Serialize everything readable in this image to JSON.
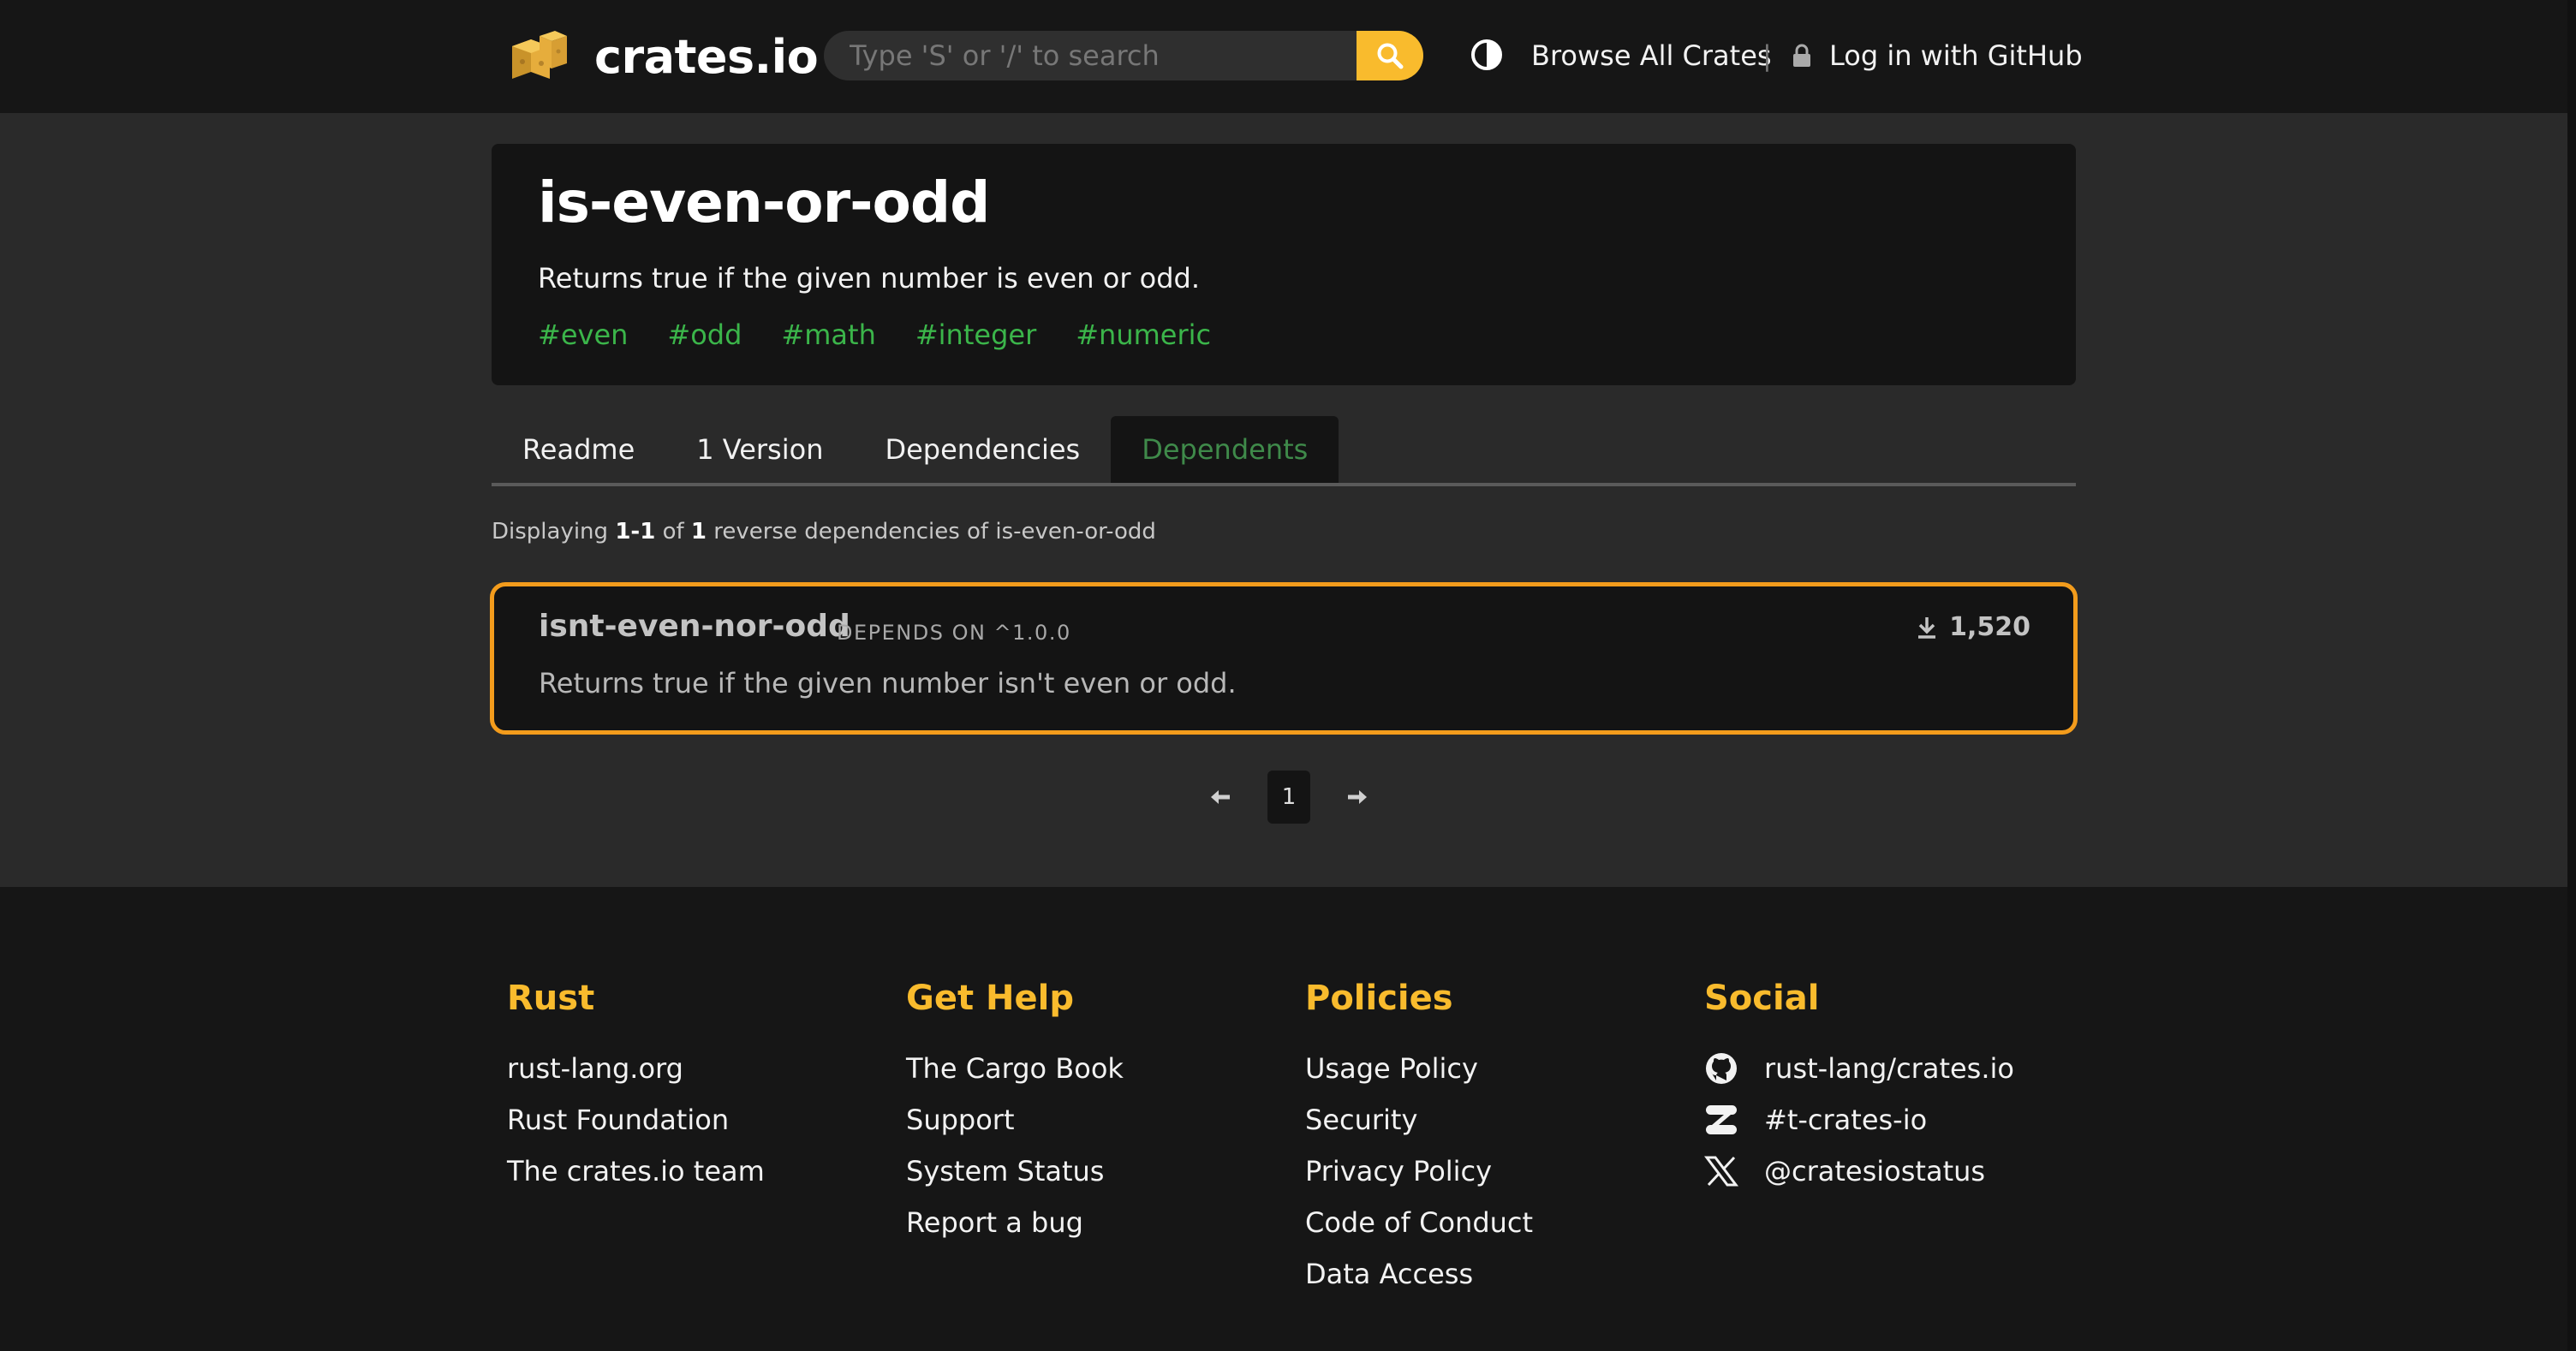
{
  "header": {
    "logo_text": "crates.io",
    "search_placeholder": "Type 'S' or '/' to search",
    "browse_label": "Browse All Crates",
    "separator": "|",
    "login_label": "Log in with GitHub"
  },
  "crate": {
    "name": "is-even-or-odd",
    "description": "Returns true if the given number is even or odd.",
    "keywords": [
      "#even",
      "#odd",
      "#math",
      "#integer",
      "#numeric"
    ]
  },
  "tabs": [
    {
      "label": "Readme",
      "active": false
    },
    {
      "label": "1 Version",
      "active": false
    },
    {
      "label": "Dependencies",
      "active": false
    },
    {
      "label": "Dependents",
      "active": true
    }
  ],
  "summary": {
    "prefix": "Displaying",
    "range": "1-1",
    "of": "of",
    "total": "1",
    "suffix": "reverse dependencies of is-even-or-odd"
  },
  "dependents": [
    {
      "name": "isnt-even-nor-odd",
      "requirement": "DEPENDS ON ^1.0.0",
      "downloads": "1,520",
      "description": "Returns true if the given number isn't even or odd."
    }
  ],
  "pagination": {
    "current_page": "1"
  },
  "footer": {
    "columns": [
      {
        "title": "Rust",
        "links": [
          "rust-lang.org",
          "Rust Foundation",
          "The crates.io team"
        ]
      },
      {
        "title": "Get Help",
        "links": [
          "The Cargo Book",
          "Support",
          "System Status",
          "Report a bug"
        ]
      },
      {
        "title": "Policies",
        "links": [
          "Usage Policy",
          "Security",
          "Privacy Policy",
          "Code of Conduct",
          "Data Access"
        ]
      },
      {
        "title": "Social",
        "links": [
          {
            "icon": "github-icon",
            "label": "rust-lang/crates.io"
          },
          {
            "icon": "zulip-icon",
            "label": "#t-crates-io"
          },
          {
            "icon": "x-icon",
            "label": "@cratesiostatus"
          }
        ]
      }
    ]
  },
  "colors": {
    "accent_yellow": "#f9bb2d",
    "keyword_green": "#3bb54a",
    "card_border_orange": "#f39c1c",
    "background": "#2a2a2a",
    "header_bg": "#161616"
  }
}
